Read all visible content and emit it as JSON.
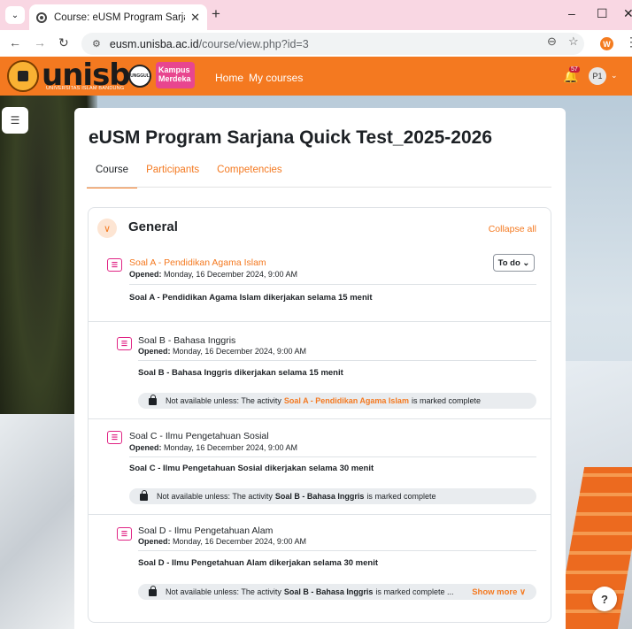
{
  "browser": {
    "tab_title": "Course: eUSM Program Sarjana",
    "url_domain": "eusm.unisba.ac.id",
    "url_path": "/course/view.php?id=3",
    "profile_initial": "W"
  },
  "navbar": {
    "logo_text": "unisba",
    "logo_subtext": "UNIVERSITAS ISLAM BANDUNG",
    "unggul_text": "UNGGUL",
    "kampus_text": "Kampus Merdeka",
    "links": [
      "Home",
      "My courses"
    ],
    "notification_count": "57",
    "user_initials": "P1",
    "accent_color": "#f47920"
  },
  "course": {
    "title": "eUSM Program Sarjana Quick Test_2025-2026",
    "tabs": [
      "Course",
      "Participants",
      "Competencies"
    ]
  },
  "section": {
    "title": "General",
    "collapse_label": "Collapse all",
    "todo_label": "To do"
  },
  "activities": [
    {
      "name": "Soal A - Pendidikan Agama Islam",
      "opened_label": "Opened:",
      "opened_value": "Monday, 16 December 2024, 9:00 AM",
      "description": "Soal A - Pendidikan Agama Islam dikerjakan selama 15 menit"
    },
    {
      "name": "Soal B - Bahasa Inggris",
      "opened_label": "Opened:",
      "opened_value": "Monday, 16 December 2024, 9:00 AM",
      "description": "Soal B - Bahasa Inggris dikerjakan selama 15 menit",
      "restrict_pre": "Not available unless: The activity",
      "restrict_activity": "Soal A - Pendidikan Agama Islam",
      "restrict_post": "is marked complete"
    },
    {
      "name": "Soal C - Ilmu Pengetahuan Sosial",
      "opened_label": "Opened:",
      "opened_value": "Monday, 16 December 2024, 9:00 AM",
      "description": "Soal C - Ilmu Pengetahuan Sosial dikerjakan selama 30 menit",
      "restrict_pre": "Not available unless: The activity",
      "restrict_activity": "Soal B - Bahasa Inggris",
      "restrict_post": "is marked complete"
    },
    {
      "name": "Soal D - Ilmu Pengetahuan Alam",
      "opened_label": "Opened:",
      "opened_value": "Monday, 16 December 2024, 9:00 AM",
      "description": "Soal D - Ilmu Pengetahuan Alam dikerjakan selama 30 menit",
      "restrict_pre": "Not available unless: The activity",
      "restrict_activity": "Soal B - Bahasa Inggris",
      "restrict_post": "is marked complete ...",
      "show_more": "Show more"
    }
  ],
  "help_label": "?"
}
